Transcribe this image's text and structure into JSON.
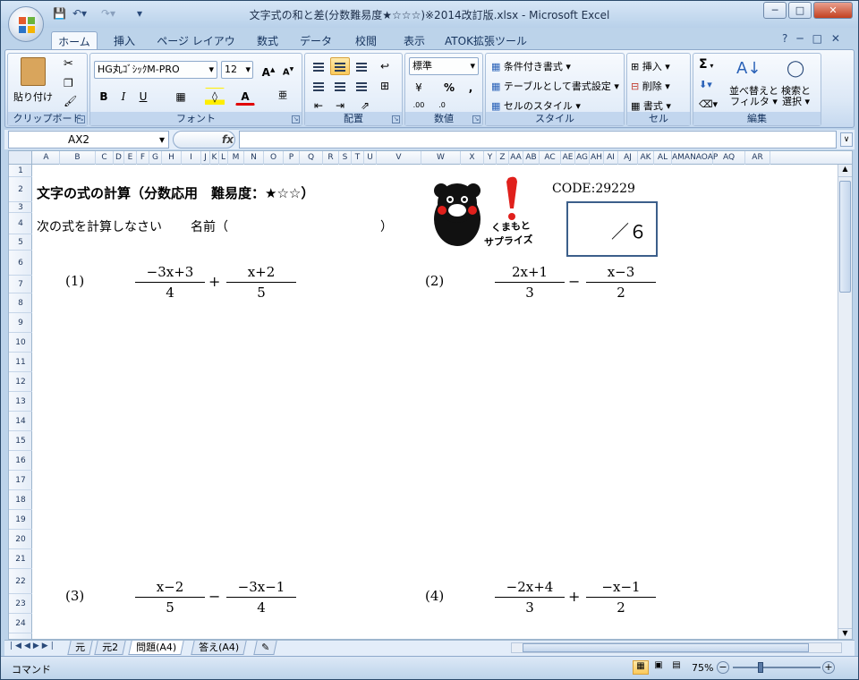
{
  "window": {
    "title": "文字式の和と差(分数難易度★☆☆☆)※2014改訂版.xlsx - Microsoft Excel",
    "controls": [
      "─",
      "□",
      "✕"
    ]
  },
  "ribbon_tabs": [
    "ホーム",
    "挿入",
    "ページ レイアウト",
    "数式",
    "データ",
    "校閲",
    "表示",
    "ATOK拡張ツール"
  ],
  "ribbon": {
    "clipboard": {
      "paste": "貼り付け",
      "label": "クリップボード"
    },
    "font": {
      "name": "HG丸ｺﾞｼｯｸM-PRO",
      "size": "12",
      "bold": "B",
      "italic": "I",
      "underline": "U",
      "color_letter": "A",
      "label": "フォント"
    },
    "alignment": {
      "label": "配置"
    },
    "number": {
      "format": "標準",
      "percent": "%",
      "comma": ",",
      "label": "数値"
    },
    "styles": {
      "conditional": "条件付き書式",
      "table": "テーブルとして書式設定",
      "cell_styles": "セルのスタイル",
      "label": "スタイル"
    },
    "cells": {
      "insert": "挿入",
      "delete": "削除",
      "format": "書式",
      "label": "セル"
    },
    "editing": {
      "sigma": "Σ",
      "sort_filter_1": "並べ替えと",
      "sort_filter_2": "フィルタ",
      "find_1": "検索と",
      "find_2": "選択",
      "label": "編集"
    }
  },
  "formula_bar": {
    "name_box": "AX2",
    "fx": "fx",
    "value": ""
  },
  "columns": [
    "A",
    "B",
    "C",
    "D",
    "E",
    "F",
    "G",
    "H",
    "I",
    "J",
    "K",
    "L",
    "M",
    "N",
    "O",
    "P",
    "Q",
    "R",
    "S",
    "T",
    "U",
    "V",
    "W",
    "X",
    "Y",
    "Z",
    "AA",
    "AB",
    "AC",
    "AE",
    "AG",
    "AH",
    "AI",
    "AJ",
    "AK",
    "AL",
    "AMANAOAP",
    "AQ",
    "AR"
  ],
  "rows": [
    "1",
    "2",
    "3",
    "4",
    "5",
    "6",
    "7",
    "8",
    "9",
    "10",
    "11",
    "12",
    "13",
    "14",
    "15",
    "16",
    "17",
    "18",
    "19",
    "20",
    "21",
    "22",
    "23",
    "24"
  ],
  "worksheet": {
    "title": "文字の式の計算（分数応用　難易度：★☆☆）",
    "instruction": "次の式を計算しなさい",
    "name_label": "名前（",
    "name_close": "）",
    "code": "CODE:29229",
    "score": "／６",
    "logo_text_1": "くまもと",
    "logo_text_2": "サプライズ",
    "problems": [
      {
        "label": "(1)",
        "a_num": "−3x+3",
        "a_den": "4",
        "op": "+",
        "b_num": "x+2",
        "b_den": "5"
      },
      {
        "label": "(2)",
        "a_num": "2x+1",
        "a_den": "3",
        "op": "−",
        "b_num": "x−3",
        "b_den": "2"
      },
      {
        "label": "(3)",
        "a_num": "x−2",
        "a_den": "5",
        "op": "−",
        "b_num": "−3x−1",
        "b_den": "4"
      },
      {
        "label": "(4)",
        "a_num": "−2x+4",
        "a_den": "3",
        "op": "+",
        "b_num": "−x−1",
        "b_den": "2"
      }
    ]
  },
  "sheet_tabs": [
    "元",
    "元2",
    "問題(A4)",
    "答え(A4)"
  ],
  "status": {
    "mode": "コマンド",
    "zoom": "75%"
  }
}
